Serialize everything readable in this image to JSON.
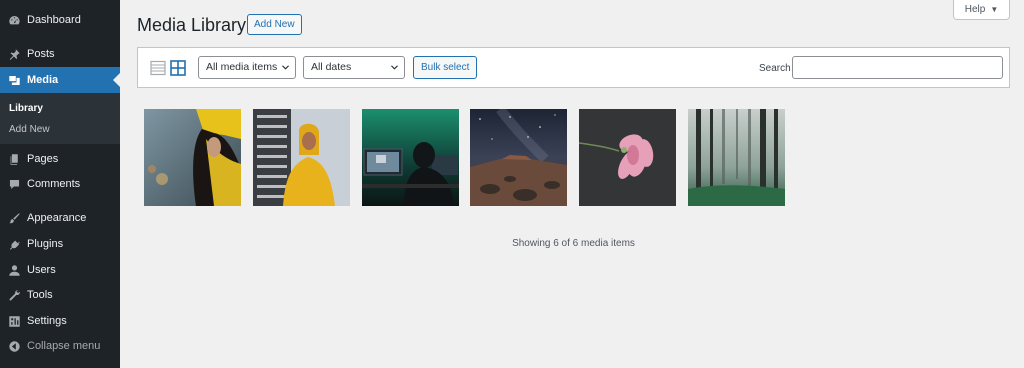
{
  "sidebar": {
    "items": [
      {
        "label": "Dashboard",
        "icon": "dashboard-icon"
      },
      {
        "label": "Posts",
        "icon": "pushpin-icon"
      },
      {
        "label": "Media",
        "icon": "media-icon",
        "active": true
      },
      {
        "label": "Pages",
        "icon": "pages-icon"
      },
      {
        "label": "Comments",
        "icon": "comment-icon"
      },
      {
        "label": "Appearance",
        "icon": "paintbrush-icon"
      },
      {
        "label": "Plugins",
        "icon": "plug-icon"
      },
      {
        "label": "Users",
        "icon": "user-icon"
      },
      {
        "label": "Tools",
        "icon": "wrench-icon"
      },
      {
        "label": "Settings",
        "icon": "settings-icon"
      }
    ],
    "submenu": [
      {
        "label": "Library",
        "current": true
      },
      {
        "label": "Add New"
      }
    ],
    "collapse_label": "Collapse menu"
  },
  "header": {
    "title": "Media Library",
    "add_new_label": "Add New",
    "help_label": "Help"
  },
  "toolbar": {
    "filter_type": "All media items",
    "filter_date": "All dates",
    "bulk_select_label": "Bulk select",
    "search_label": "Search",
    "search_value": ""
  },
  "media": {
    "items": [
      {
        "subject": "person in yellow hat",
        "icon": "image-thumbnail"
      },
      {
        "subject": "person in yellow hoodie",
        "icon": "image-thumbnail"
      },
      {
        "subject": "person at computer monitors",
        "icon": "image-thumbnail"
      },
      {
        "subject": "night sky over desert",
        "icon": "image-thumbnail"
      },
      {
        "subject": "pink flower",
        "icon": "image-thumbnail"
      },
      {
        "subject": "misty forest",
        "icon": "image-thumbnail"
      }
    ],
    "count_text": "Showing 6 of 6 media items"
  },
  "colors": {
    "sidebar_bg": "#1d2327",
    "accent": "#2271b1",
    "page_bg": "#f0f0f1"
  }
}
